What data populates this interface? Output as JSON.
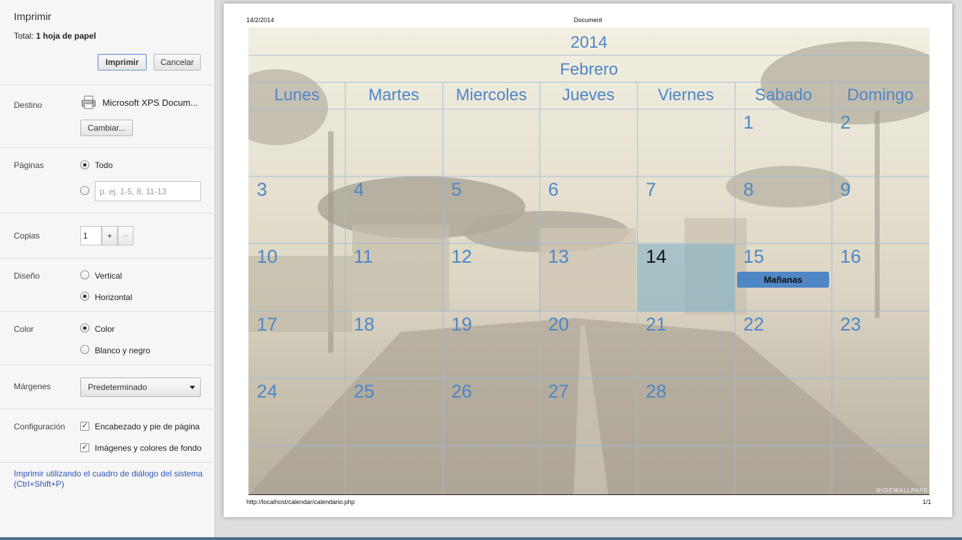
{
  "sidebar": {
    "title": "Imprimir",
    "total_label": "Total:",
    "total_value": "1 hoja de papel",
    "print_button": "Imprimir",
    "cancel_button": "Cancelar",
    "destination": {
      "label": "Destino",
      "printer": "Microsoft XPS Docum...",
      "change_button": "Cambiar...",
      "icon": "printer-icon"
    },
    "pages": {
      "label": "Páginas",
      "all_option": "Todo",
      "all_selected": true,
      "range_placeholder": "p. ej. 1-5, 8, 11-13"
    },
    "copies": {
      "label": "Copias",
      "value": "1",
      "plus": "+",
      "minus": "−"
    },
    "layout": {
      "label": "Diseño",
      "vertical": "Vertical",
      "horizontal": "Horizontal",
      "selected": "Horizontal"
    },
    "color": {
      "label": "Color",
      "color_option": "Color",
      "bw_option": "Blanco y negro",
      "selected": "Color"
    },
    "margins": {
      "label": "Márgenes",
      "selected": "Predeterminado"
    },
    "settings": {
      "label": "Configuración",
      "header_footer": "Encabezado y pie de página",
      "header_footer_checked": true,
      "backgrounds": "Imágenes y colores de fondo",
      "backgrounds_checked": true
    },
    "system_dialog_link": "Imprimir utilizando el cuadro de diálogo del sistema (Ctrl+Shift+P)"
  },
  "preview": {
    "date": "14/2/2014",
    "doc_title": "Document",
    "url": "http://localhost/calendar/calendario.php",
    "page_count": "1/1",
    "watermark": "WIDEWALLPAPE",
    "calendar": {
      "year": "2014",
      "month": "Febrero",
      "day_names": [
        "Lunes",
        "Martes",
        "Miercoles",
        "Jueves",
        "Viernes",
        "Sabado",
        "Domingo"
      ],
      "weeks": [
        [
          "",
          "",
          "",
          "",
          "",
          "1",
          "2"
        ],
        [
          "3",
          "4",
          "5",
          "6",
          "7",
          "8",
          "9"
        ],
        [
          "10",
          "11",
          "12",
          "13",
          "14",
          "15",
          "16"
        ],
        [
          "17",
          "18",
          "19",
          "20",
          "21",
          "22",
          "23"
        ],
        [
          "24",
          "25",
          "26",
          "27",
          "28",
          "",
          ""
        ],
        [
          "",
          "",
          "",
          "",
          "",
          "",
          ""
        ]
      ],
      "today": "14",
      "event": {
        "day": "15",
        "label": "Mañanas"
      },
      "accent": "#4e86c6"
    }
  }
}
